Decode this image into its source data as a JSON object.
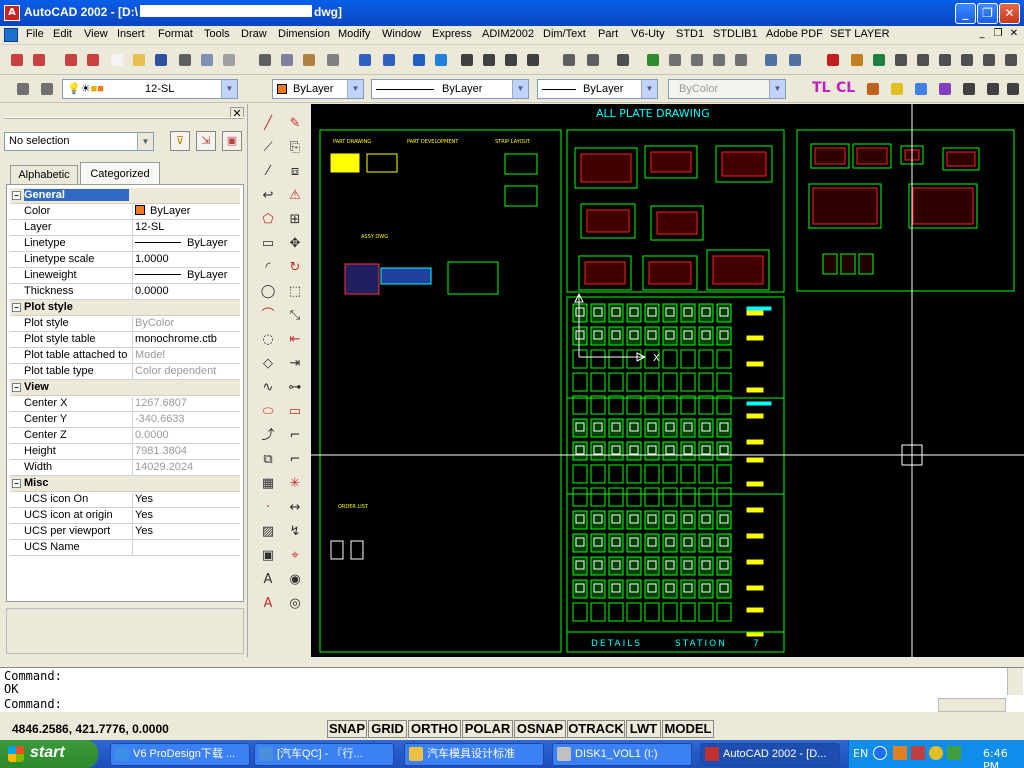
{
  "window": {
    "title": "AutoCAD 2002 - [D:\\",
    "title_suffix": "dwg]",
    "controls": {
      "minimize": "_",
      "maximize": "❐",
      "close": "✕"
    }
  },
  "menu": [
    "File",
    "Edit",
    "View",
    "Insert",
    "Format",
    "Tools",
    "Draw",
    "Dimension",
    "Modify",
    "Window",
    "Express",
    "ADIM2002",
    "Dim/Text",
    "Part",
    "V6-Uty",
    "STD1",
    "STDLIB1",
    "Adobe PDF",
    "SET LAYER"
  ],
  "layer_toolbar": {
    "layer": "12-SL",
    "color": "ByLayer",
    "linetype": "ByLayer",
    "lineweight": "ByLayer",
    "plotstyle": "ByColor",
    "tl": "TL",
    "cl": "CL"
  },
  "properties": {
    "selection": "No selection",
    "tabs": [
      "Alphabetic",
      "Categorized"
    ],
    "active_tab": "Categorized",
    "rows": [
      {
        "key": "General",
        "cat": true,
        "sel": true
      },
      {
        "key": "Color",
        "value": "ByLayer",
        "swatch": "#f07820"
      },
      {
        "key": "Layer",
        "value": "12-SL"
      },
      {
        "key": "Linetype",
        "value": "ByLayer",
        "line": true
      },
      {
        "key": "Linetype scale",
        "value": "1.0000"
      },
      {
        "key": "Lineweight",
        "value": "ByLayer",
        "line": true
      },
      {
        "key": "Thickness",
        "value": "0.0000"
      },
      {
        "key": "Plot style",
        "cat": true
      },
      {
        "key": "Plot style",
        "value": "ByColor",
        "grey": true
      },
      {
        "key": "Plot style table",
        "value": "monochrome.ctb"
      },
      {
        "key": "Plot table attached to",
        "value": "Model",
        "grey": true
      },
      {
        "key": "Plot table type",
        "value": "Color dependent",
        "grey": true
      },
      {
        "key": "View",
        "cat": true
      },
      {
        "key": "Center X",
        "value": "1267.6807",
        "grey": true
      },
      {
        "key": "Center Y",
        "value": "-340.6633",
        "grey": true
      },
      {
        "key": "Center Z",
        "value": "0.0000",
        "grey": true
      },
      {
        "key": "Height",
        "value": "7981.3804",
        "grey": true
      },
      {
        "key": "Width",
        "value": "14029.2024",
        "grey": true
      },
      {
        "key": "Misc",
        "cat": true
      },
      {
        "key": "UCS icon On",
        "value": "Yes"
      },
      {
        "key": "UCS icon at origin",
        "value": "Yes"
      },
      {
        "key": "UCS per viewport",
        "value": "Yes"
      },
      {
        "key": "UCS Name",
        "value": ""
      }
    ]
  },
  "drawing": {
    "title": "ALL PLATE DRAWING",
    "footer_left": "DETAILS",
    "footer_right": "STATION",
    "footer_num": "7",
    "labels": [
      "PART DRAWING",
      "PART DEVELOPMENT",
      "STRIP LAYOUT",
      "ASSY DWG",
      "ORDER LIST"
    ]
  },
  "command": {
    "line1": "Command:",
    "line2": "OK",
    "line3": "Command:"
  },
  "status": {
    "coords": "4846.2586, 421.7776, 0.0000",
    "buttons": [
      "SNAP",
      "GRID",
      "ORTHO",
      "POLAR",
      "OSNAP",
      "OTRACK",
      "LWT",
      "MODEL"
    ]
  },
  "taskbar": {
    "start": "start",
    "tasks": [
      {
        "label": "V6 ProDesign下载 ...",
        "icon": "#3a8ee6"
      },
      {
        "label": "[汽车QC] - 『行...",
        "icon": "#4a90d9"
      },
      {
        "label": "汽车模具设计标准",
        "icon": "#f0c040"
      },
      {
        "label": "DISK1_VOL1 (I:)",
        "icon": "#c0c0c0"
      },
      {
        "label": "AutoCAD 2002 - [D...",
        "icon": "#c03030",
        "active": true
      }
    ],
    "lang": "EN",
    "clock": "6:46 PM"
  },
  "colors": {
    "accent": "#0a5fe8",
    "canvas": "#000000",
    "cad_green": "#00ff00",
    "cad_yellow": "#ffff00",
    "cad_cyan": "#00ffff"
  }
}
